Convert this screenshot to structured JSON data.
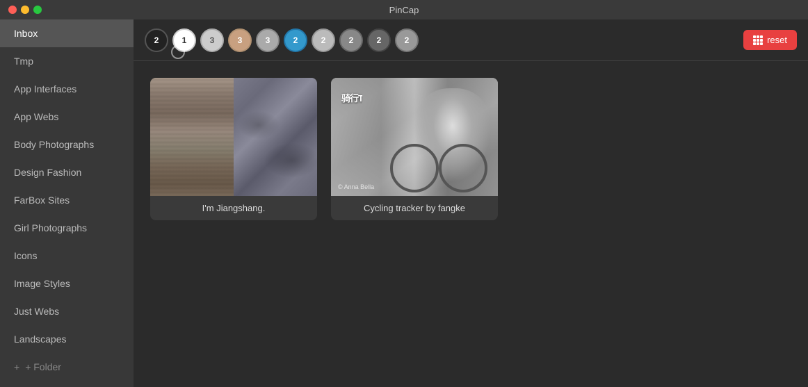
{
  "titleBar": {
    "appName": "PinCap"
  },
  "sidebar": {
    "items": [
      {
        "id": "inbox",
        "label": "Inbox",
        "active": true
      },
      {
        "id": "tmp",
        "label": "Tmp"
      },
      {
        "id": "app-interfaces",
        "label": "App Interfaces"
      },
      {
        "id": "app-webs",
        "label": "App Webs"
      },
      {
        "id": "body-photographs",
        "label": "Body Photographs"
      },
      {
        "id": "design-fashion",
        "label": "Design Fashion"
      },
      {
        "id": "farbox-sites",
        "label": "FarBox Sites"
      },
      {
        "id": "girl-photographs",
        "label": "Girl Photographs"
      },
      {
        "id": "icons",
        "label": "Icons"
      },
      {
        "id": "image-styles",
        "label": "Image Styles"
      },
      {
        "id": "just-webs",
        "label": "Just Webs"
      },
      {
        "id": "landscapes",
        "label": "Landscapes"
      }
    ],
    "addFolderLabel": "+ Folder"
  },
  "topBar": {
    "avatars": [
      {
        "id": "a1",
        "count": "2",
        "color": "#222222",
        "initials": ""
      },
      {
        "id": "a2",
        "count": "1",
        "color": "#ffffff",
        "initials": "",
        "active": true
      },
      {
        "id": "a3",
        "count": "3",
        "color": "#dddddd",
        "initials": ""
      },
      {
        "id": "a4",
        "count": "3",
        "color": "#c8a080",
        "initials": ""
      },
      {
        "id": "a5",
        "count": "3",
        "color": "#aaaaaa",
        "initials": ""
      },
      {
        "id": "a6",
        "count": "2",
        "color": "#3399cc",
        "initials": ""
      },
      {
        "id": "a7",
        "count": "2",
        "color": "#bbbbbb",
        "initials": ""
      },
      {
        "id": "a8",
        "count": "2",
        "color": "#888888",
        "initials": ""
      },
      {
        "id": "a9",
        "count": "2",
        "color": "#666666",
        "initials": ""
      },
      {
        "id": "a10",
        "count": "2",
        "color": "#999999",
        "initials": ""
      }
    ],
    "resetButton": "reset"
  },
  "cards": [
    {
      "id": "card-1",
      "title": "I'm Jiangshang.",
      "type": "texture"
    },
    {
      "id": "card-2",
      "title": "Cycling tracker by fangke",
      "type": "cycling",
      "logoSymbol": "骑行TM",
      "copyright": "© Anna Bella"
    }
  ]
}
